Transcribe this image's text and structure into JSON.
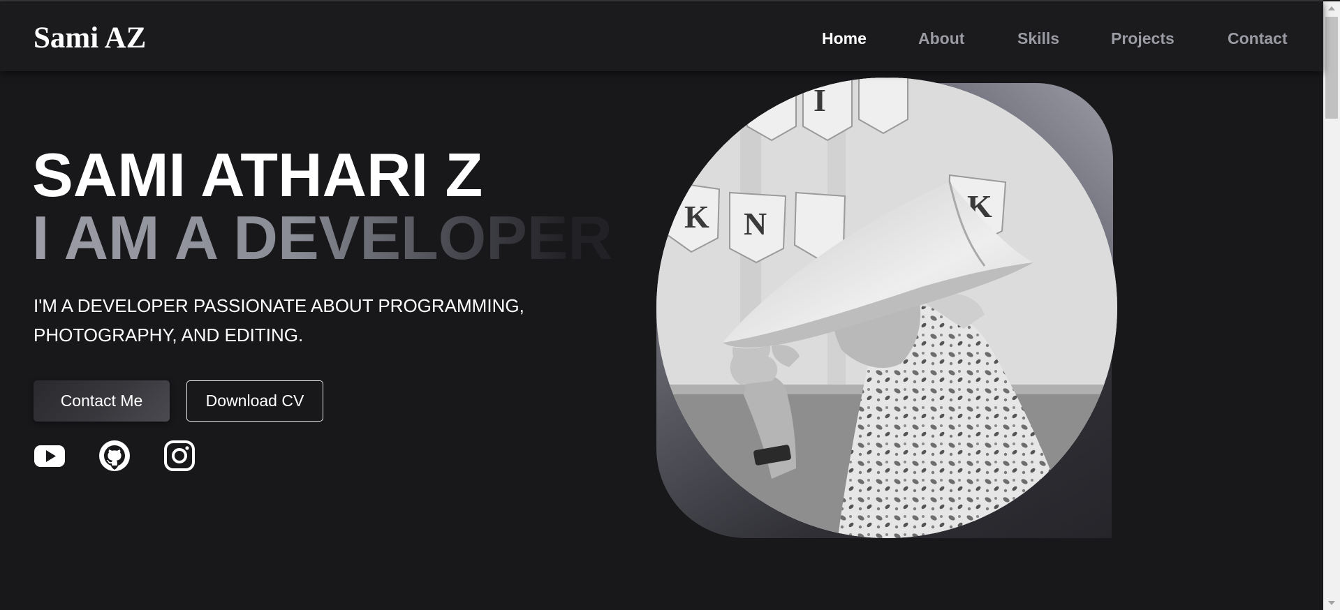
{
  "brand": {
    "logo": "Sami AZ"
  },
  "nav": {
    "items": [
      {
        "label": "Home",
        "active": true
      },
      {
        "label": "About",
        "active": false
      },
      {
        "label": "Skills",
        "active": false
      },
      {
        "label": "Projects",
        "active": false
      },
      {
        "label": "Contact",
        "active": false
      }
    ]
  },
  "hero": {
    "name": "SAMI ATHARI Z",
    "role": "I AM A DEVELOPER",
    "description": "I'M A DEVELOPER PASSIONATE ABOUT PROGRAMMING, PHOTOGRAPHY, AND EDITING.",
    "buttons": {
      "contact": "Contact Me",
      "download": "Download CV"
    },
    "socials": [
      "youtube-icon",
      "github-icon",
      "instagram-icon"
    ]
  },
  "colors": {
    "background": "#18181b",
    "header": "#1b1b1e",
    "nav_inactive": "#9a9ba3",
    "text": "#ffffff"
  }
}
